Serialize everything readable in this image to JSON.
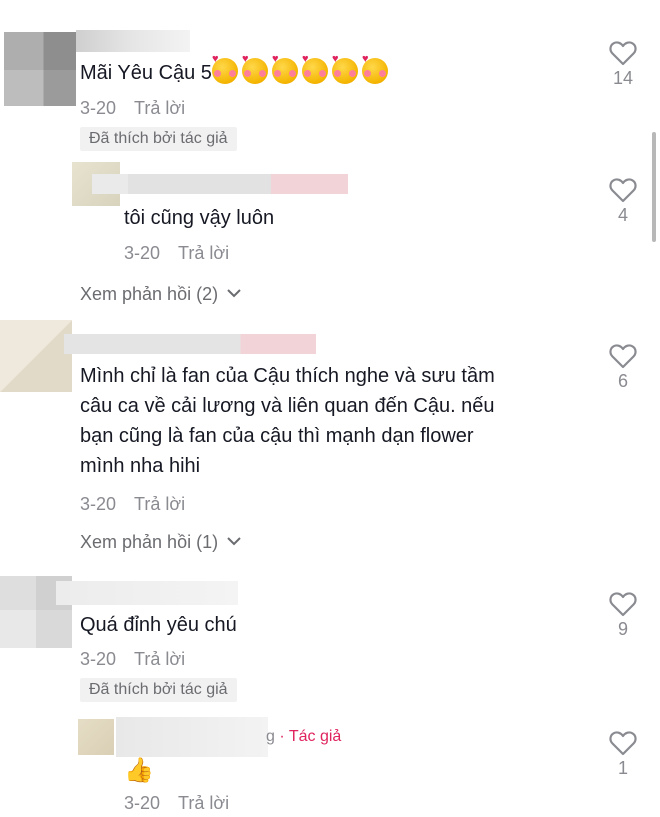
{
  "comments": [
    {
      "text": "Mãi Yêu Cậu 5",
      "emoji_count": 6,
      "emoji_name": "smiling-face-with-hearts",
      "date": "3-20",
      "reply_label": "Trả lời",
      "liked_by_author": "Đã thích bởi tác giả",
      "likes": "14"
    },
    {
      "text": "tôi cũng vậy luôn",
      "date": "3-20",
      "reply_label": "Trả lời",
      "likes": "4"
    },
    {
      "view_replies": "Xem phản hồi (2)"
    },
    {
      "text_lines": [
        "Mình chỉ là fan của Cậu thích nghe và sưu tầm",
        "câu ca về cải lương và liên quan đến Cậu. nếu",
        "bạn cũng là fan của cậu thì mạnh dạn flower",
        "mình nha hihi"
      ],
      "date": "3-20",
      "reply_label": "Trả lời",
      "likes": "6",
      "view_replies": "Xem phản hồi (1)"
    },
    {
      "text": "Quá đỉnh yêu chú",
      "date": "3-20",
      "reply_label": "Trả lời",
      "liked_by_author": "Đã thích bởi tác giả",
      "likes": "9"
    },
    {
      "author_suffix": "g",
      "author_tag": "· Tác giả",
      "emoji_name": "thumbs-up",
      "emoji": "👍",
      "date": "3-20",
      "reply_label": "Trả lời",
      "likes": "1"
    }
  ],
  "icons": {
    "like": "heart-outline-icon",
    "chevron": "chevron-down-icon"
  },
  "colors": {
    "text": "#161823",
    "meta": "#8a8b91",
    "author_tag": "#e0245e",
    "badge_bg": "#f1f1f2"
  }
}
